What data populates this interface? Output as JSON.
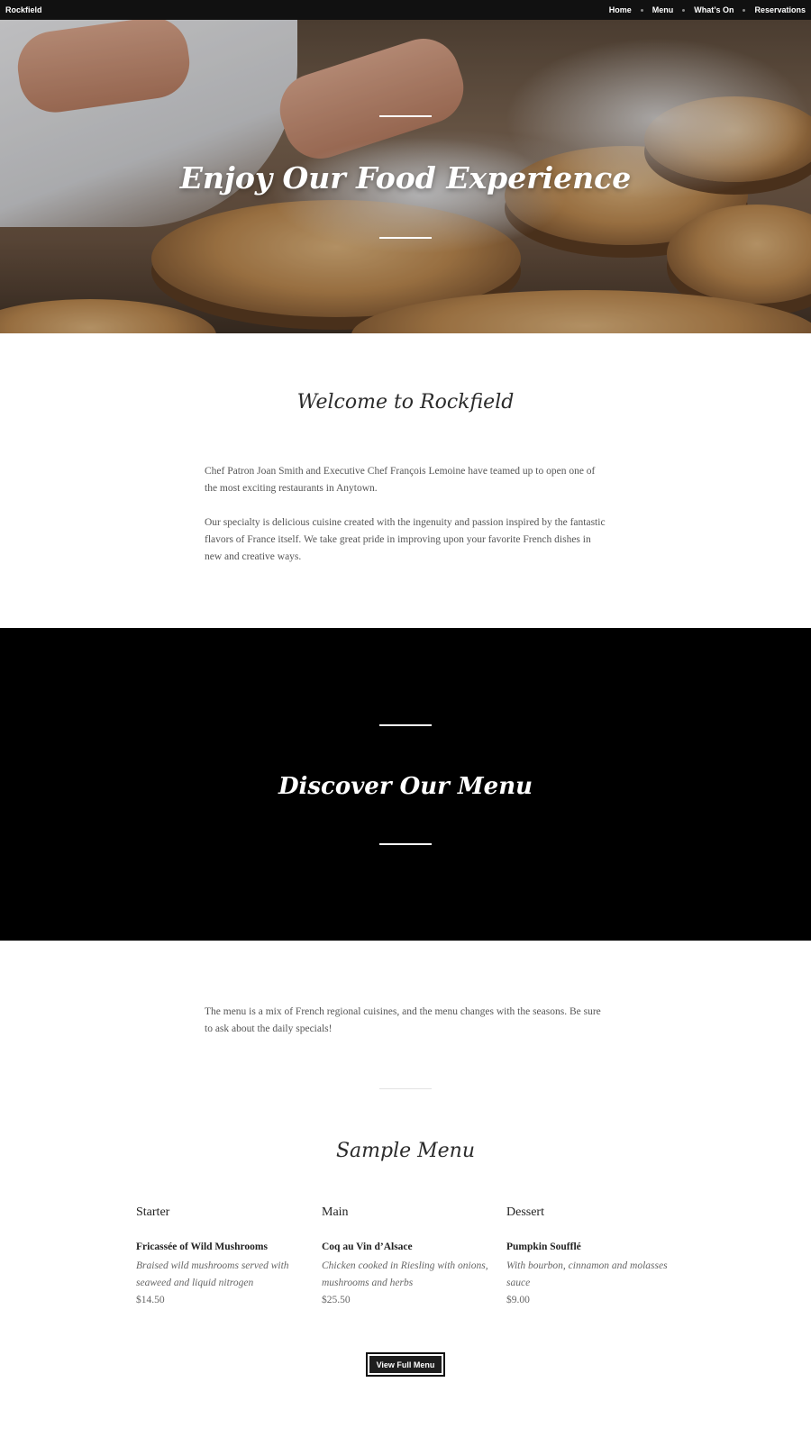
{
  "brand": "Rockfield",
  "nav": {
    "items": [
      {
        "label": "Home"
      },
      {
        "label": "Menu"
      },
      {
        "label": "What’s On"
      },
      {
        "label": "Reservations"
      }
    ]
  },
  "hero": {
    "title": "Enjoy Our Food Experience"
  },
  "welcome": {
    "title": "Welcome to Rockfield",
    "paragraph1": "Chef Patron Joan Smith and Executive Chef François Lemoine have teamed up to open one of the most exciting restaurants in Anytown.",
    "paragraph2": "Our specialty is delicious cuisine created with the ingenuity and passion inspired by the fantastic flavors of France itself. We take great pride in improving upon your favorite French dishes in new and creative ways."
  },
  "discover": {
    "title": "Discover Our Menu",
    "intro": "The menu is a mix of French regional cuisines, and the menu changes with the seasons. Be sure to ask about the daily specials!"
  },
  "sample_menu": {
    "title": "Sample Menu",
    "columns": [
      {
        "course": "Starter",
        "dish": "Fricassée of Wild Mushrooms",
        "description": "Braised wild mushrooms served with seaweed and liquid nitrogen",
        "price": "$14.50"
      },
      {
        "course": "Main",
        "dish": "Coq au Vin d’Alsace",
        "description": "Chicken cooked in Riesling with onions, mushrooms and herbs",
        "price": "$25.50"
      },
      {
        "course": "Dessert",
        "dish": "Pumpkin Soufflé",
        "description": "With bourbon, cinnamon and molasses sauce",
        "price": "$9.00"
      }
    ],
    "button_label": "View Full Menu"
  }
}
